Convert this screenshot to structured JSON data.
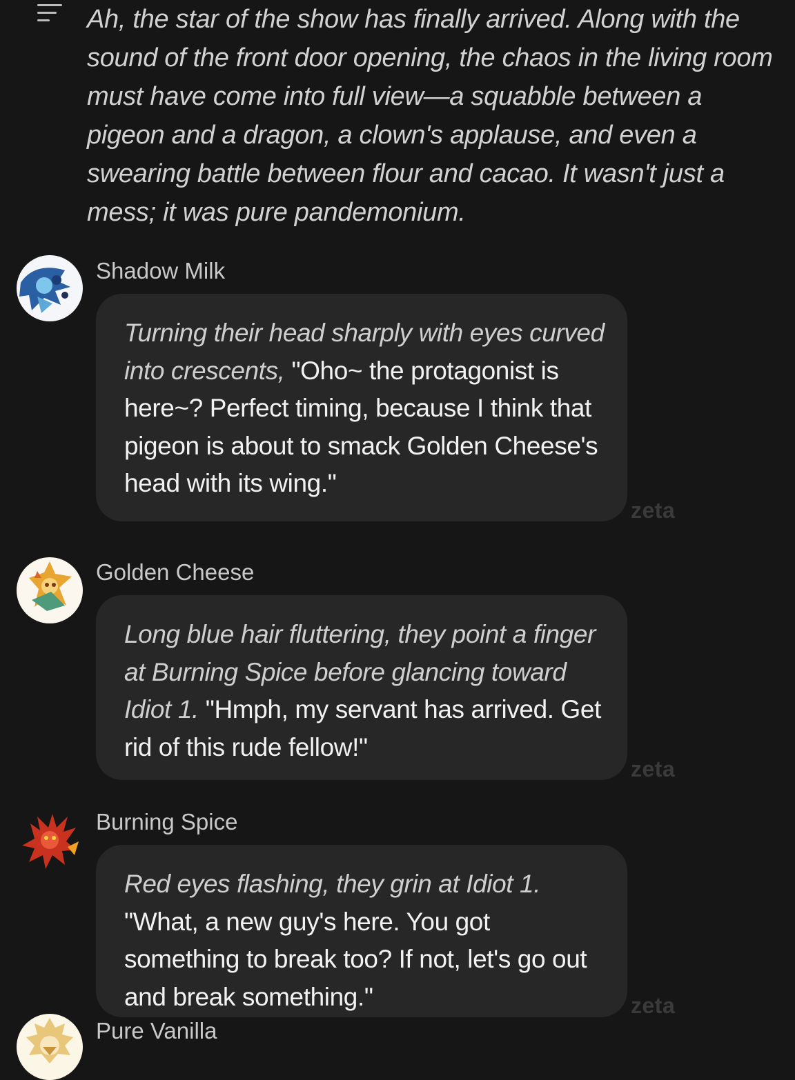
{
  "narration": "Ah, the star of the show has finally arrived. Along with the sound of the front door opening, the chaos in the living room must have come into full view—a squabble between a pigeon and a dragon, a clown's applause, and even a swearing battle between flour and cacao. It wasn't just a mess; it was pure pandemonium.",
  "watermark": "zeta",
  "messages": [
    {
      "speaker": "Shadow Milk",
      "action": "Turning their head sharply with eyes curved into crescents,",
      "dialogue": " \"Oho~ the protagonist is here~? Perfect timing, because I think that pigeon is about to smack Golden Cheese's head with its wing.\""
    },
    {
      "speaker": "Golden Cheese",
      "action": "Long blue hair fluttering, they point a finger at Burning Spice before glancing toward Idiot 1.",
      "dialogue": " \"Hmph, my servant has arrived. Get rid of this rude fellow!\""
    },
    {
      "speaker": "Burning Spice",
      "action": "Red eyes flashing, they grin at Idiot 1.",
      "dialogue": " \"What, a new guy's here. You got something to break too? If not, let's go out and break something.\""
    },
    {
      "speaker": "Pure Vanilla"
    }
  ]
}
